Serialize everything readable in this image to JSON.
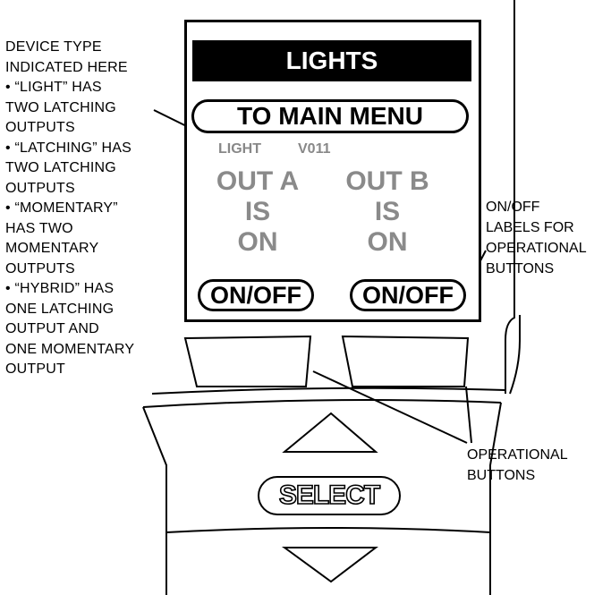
{
  "left_annotation": [
    "DEVICE TYPE",
    "INDICATED HERE",
    "• “LIGHT” HAS",
    "TWO LATCHING",
    "OUTPUTS",
    "• “LATCHING” HAS",
    "TWO LATCHING",
    "OUTPUTS",
    "• “MOMENTARY”",
    "HAS TWO",
    "MOMENTARY",
    "OUTPUTS",
    "• “HYBRID” HAS",
    "ONE LATCHING",
    "OUTPUT AND",
    "ONE MOMENTARY",
    "OUTPUT"
  ],
  "onoff_labels_note": [
    "ON/OFF",
    "LABELS FOR",
    "OPERATIONAL",
    "BUTTONS"
  ],
  "operational_buttons_note": [
    "OPERATIONAL",
    "BUTTONS"
  ],
  "screen": {
    "title": "LIGHTS",
    "menu_button": "TO MAIN MENU",
    "device_type": "LIGHT",
    "version": "V011",
    "out_a": {
      "name": "OUT A",
      "is": "IS",
      "state": "ON"
    },
    "out_b": {
      "name": "OUT B",
      "is": "IS",
      "state": "ON"
    },
    "left_button_label": "ON/OFF",
    "right_button_label": "ON/OFF"
  },
  "select_button": "SELECT",
  "colors": {
    "line": "#000000",
    "screen_text_grey": "#8a8a8a",
    "title_bar": "#000000"
  }
}
